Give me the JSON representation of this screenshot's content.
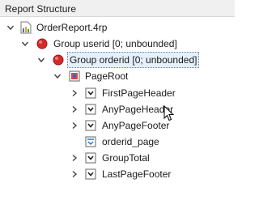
{
  "panel": {
    "title": "Report Structure"
  },
  "tree": {
    "root": {
      "label": "OrderReport.4rp",
      "icon": "report-file-icon",
      "expanded": true
    },
    "group_userid": {
      "label": "Group userid [0; unbounded]",
      "icon": "red-group-icon",
      "expanded": true
    },
    "group_orderid": {
      "label": "Group orderid [0; unbounded]",
      "icon": "red-group-icon",
      "expanded": true,
      "selected": true
    },
    "page_root": {
      "label": "PageRoot",
      "icon": "page-root-icon",
      "expanded": true
    },
    "children": [
      {
        "label": "FirstPageHeader",
        "icon": "container-icon"
      },
      {
        "label": "AnyPageHeader",
        "icon": "container-icon"
      },
      {
        "label": "AnyPageFooter",
        "icon": "container-icon"
      },
      {
        "label": "orderid_page",
        "icon": "page-break-icon"
      },
      {
        "label": "GroupTotal",
        "icon": "container-icon"
      },
      {
        "label": "LastPageFooter",
        "icon": "container-icon"
      }
    ]
  },
  "colors": {
    "group_icon": "#d42a2a",
    "selection_bg": "#e5f0fb",
    "header_bg": "#f0f0f0"
  }
}
